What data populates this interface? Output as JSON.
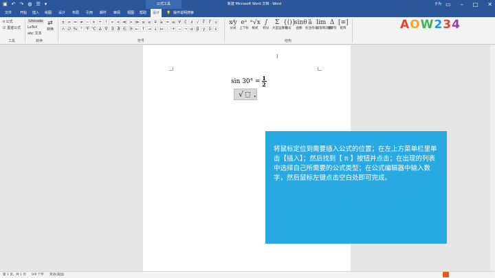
{
  "titlebar": {
    "window_title": "新建 Microsoft Word 文档 - Word",
    "context_tool": "公式工具",
    "user": "子为",
    "qat_icons": [
      "save-icon",
      "undo-icon",
      "redo-icon",
      "touch-icon",
      "list-icon",
      "customize-icon"
    ]
  },
  "tabs": [
    "文件",
    "开始",
    "插入",
    "绘图",
    "设计",
    "布局",
    "引用",
    "邮件",
    "审阅",
    "视图",
    "帮助",
    "设计"
  ],
  "tell_me": "操作说明搜索",
  "ribbon": {
    "tools": {
      "equation": "公式",
      "ink": "墨迹公式",
      "label": "工具"
    },
    "conversions": {
      "unicode": "Unicode",
      "latex": "LaTeX",
      "text": "abc 文本",
      "convert": "转换",
      "label": "转换"
    },
    "symbols": {
      "label": "符号",
      "items": [
        "±",
        "∞",
        "=",
        "≠",
        "~",
        "×",
        "÷",
        "!",
        "∝",
        "<",
        "≪",
        ">",
        "≫",
        "≤",
        "≥",
        "∓",
        "≅",
        "≈",
        "≡",
        "∀",
        "∁",
        "∂",
        "√",
        "∛",
        "∜",
        "∪",
        "∩",
        "∅",
        "%",
        "°",
        "℉",
        "℃",
        "∆",
        "∇",
        "∃",
        "∄",
        "∈",
        "∋",
        "←",
        "↑",
        "→",
        "↓",
        "↔",
        "∴",
        "+",
        "−",
        "¬",
        "α",
        "β",
        "γ",
        "δ",
        "ε"
      ]
    },
    "structures": {
      "label": "结构",
      "items": [
        {
          "glyph": "x⁄y",
          "label": "分式"
        },
        {
          "glyph": "eˣ",
          "label": "上下标"
        },
        {
          "glyph": "ⁿ√x",
          "label": "根式"
        },
        {
          "glyph": "∫",
          "label": "积分"
        },
        {
          "glyph": "Σ",
          "label": "大型运算符"
        },
        {
          "glyph": "{()}",
          "label": "括号"
        },
        {
          "glyph": "sinθ",
          "label": "函数"
        },
        {
          "glyph": "ä",
          "label": "标注符号"
        },
        {
          "glyph": "lim",
          "label": "极限和对数"
        },
        {
          "glyph": "Δ",
          "label": "运算符"
        },
        {
          "glyph": "[≡]",
          "label": "矩阵"
        }
      ]
    }
  },
  "logo": {
    "letters": [
      "A",
      "O",
      "W",
      "2",
      "3",
      "4"
    ],
    "colors": [
      "#e8432f",
      "#f5a623",
      "#3fb34f",
      "#1e90ff",
      "#e8432f",
      "#8e44ad"
    ]
  },
  "document": {
    "formula_left": "sin 30° =",
    "frac_num": "1",
    "frac_den": "2",
    "radical": "√",
    "callout": "将鼠标定位到需要插入公式的位置；在左上方菜单栏里单击【插入】；然后找到【 π 】按钮并点击；在出现的列表中选择自己所需要的公式类型；在公式编辑器中输入数字，然后鼠标左键点击空白处即可完成。"
  },
  "status": {
    "page": "第 1 页，共 1 页",
    "words": "0/9 个字",
    "lang": "英语(美国)"
  },
  "colors": {
    "accent": "#2b579a",
    "callout": "#29a9e2"
  }
}
